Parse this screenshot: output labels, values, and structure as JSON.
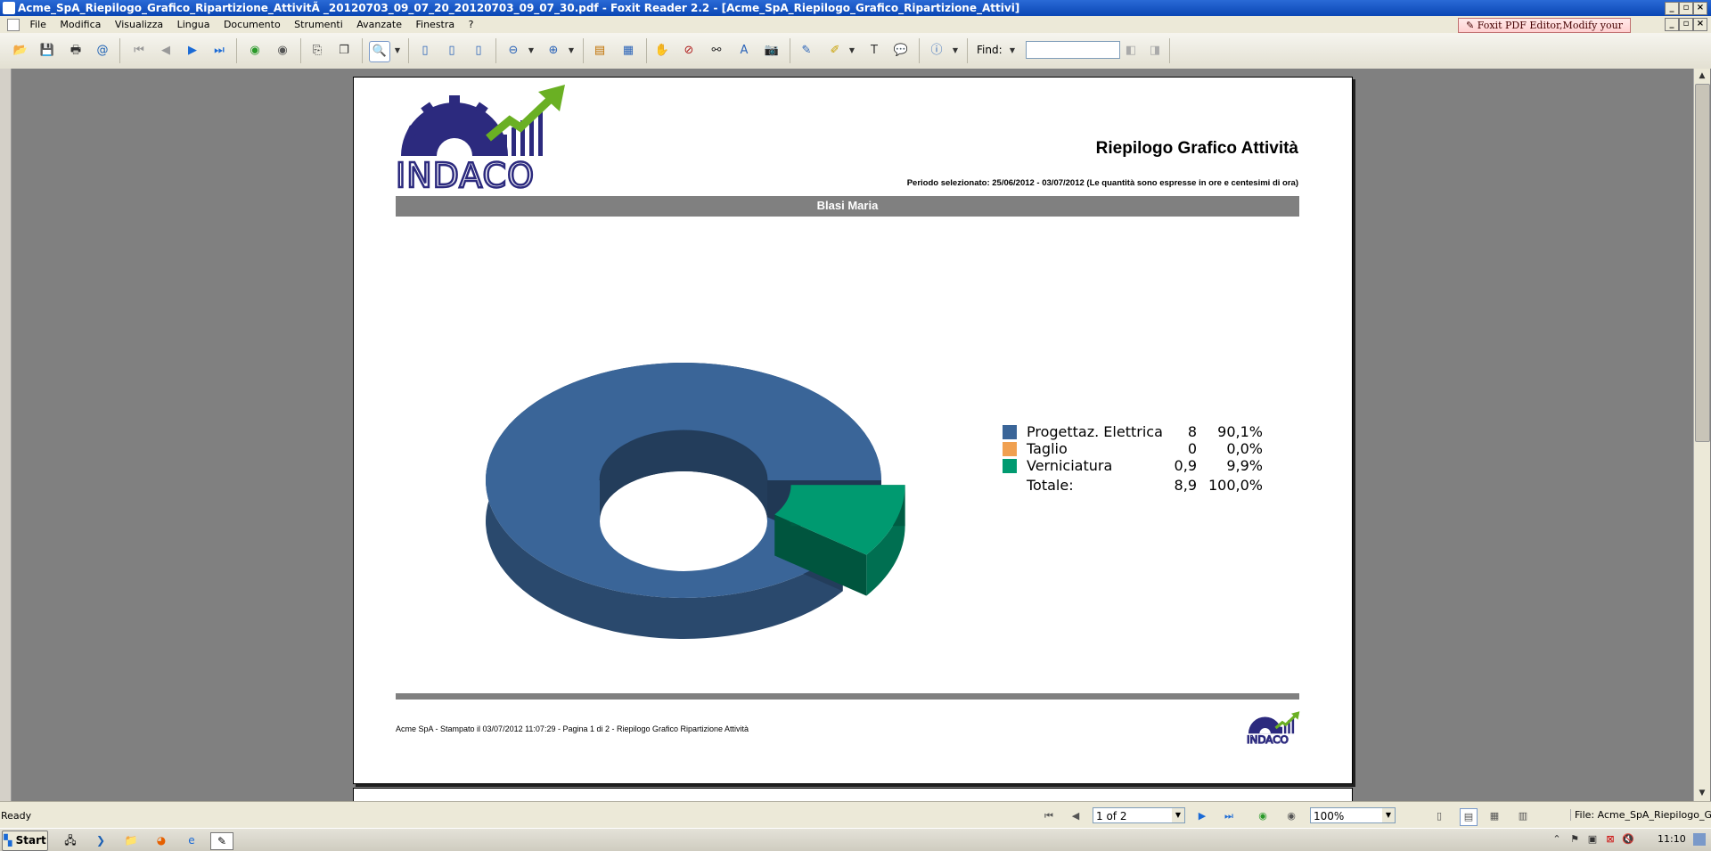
{
  "window": {
    "title": "Acme_SpA_Riepilogo_Grafico_Ripartizione_AttivitÃ _20120703_09_07_20_20120703_09_07_30.pdf - Foxit Reader 2.2 - [Acme_SpA_Riepilogo_Grafico_Ripartizione_Attivi]"
  },
  "menu": {
    "items": [
      "File",
      "Modifica",
      "Visualizza",
      "Lingua",
      "Documento",
      "Strumenti",
      "Avanzate",
      "Finestra",
      "?"
    ],
    "promo": "Foxit PDF Editor,Modify your PDF!"
  },
  "toolbar": {
    "find_label": "Find:",
    "find_value": ""
  },
  "document": {
    "logo_text": "INDACO",
    "report_title": "Riepilogo Grafico Attività",
    "period": "Periodo selezionato: 25/06/2012 - 03/07/2012  (Le quantità sono espresse in ore e centesimi di ora)",
    "person_name": "Blasi Maria",
    "footer_text": "Acme SpA - Stampato il 03/07/2012 11:07:29 - Pagina 1 di 2 - Riepilogo Grafico Ripartizione Attività"
  },
  "chart_data": {
    "type": "pie",
    "style": "3d-donut",
    "categories": [
      "Progettaz. Elettrica",
      "Taglio",
      "Verniciatura"
    ],
    "values": [
      8,
      0,
      0.9
    ],
    "value_labels": [
      "8",
      "0",
      "0,9"
    ],
    "percent_labels": [
      "90,1%",
      "0,0%",
      "9,9%"
    ],
    "colors": [
      "#3a6598",
      "#f0a050",
      "#009a70"
    ],
    "total_label": "Totale:",
    "total_value": "8,9",
    "total_percent": "100,0%"
  },
  "statusbar": {
    "status": "Ready",
    "page_indicator": "1 of 2",
    "zoom": "100%",
    "file_label": "File: Acme_SpA_Riepilogo_Grafico"
  },
  "taskbar": {
    "start_label": "Start",
    "clock": "11:10"
  }
}
